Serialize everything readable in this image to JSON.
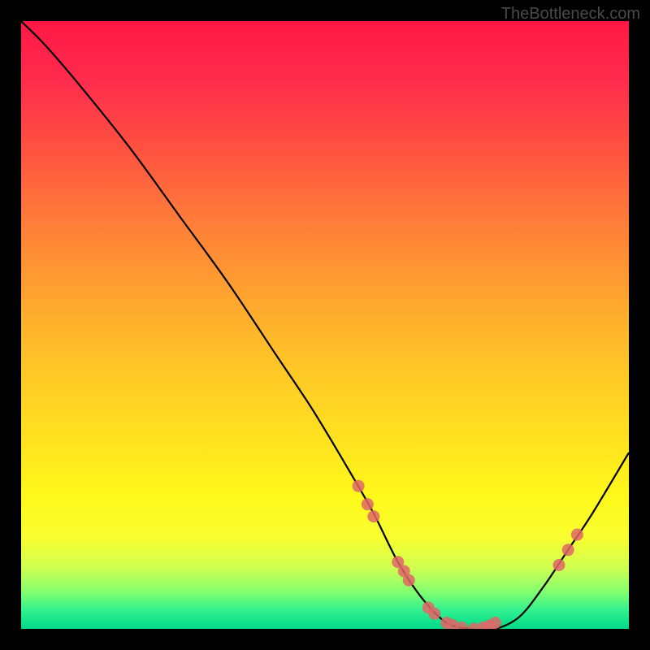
{
  "watermark": "TheBottleneck.com",
  "chart_data": {
    "type": "line",
    "title": "",
    "xlabel": "",
    "ylabel": "",
    "xlim": [
      0,
      100
    ],
    "ylim": [
      0,
      100
    ],
    "series": [
      {
        "name": "curve",
        "x": [
          0,
          4,
          10,
          18,
          26,
          34,
          42,
          48,
          54,
          58,
          62,
          66,
          70,
          74,
          78,
          82,
          86,
          90,
          94,
          100
        ],
        "y": [
          100,
          96,
          89,
          79,
          68,
          57,
          45,
          36,
          26,
          19,
          11,
          5,
          1,
          0,
          0,
          2,
          7,
          13,
          19,
          29
        ]
      }
    ],
    "markers": [
      {
        "x": 55.5,
        "y": 23.5
      },
      {
        "x": 57.0,
        "y": 20.5
      },
      {
        "x": 58.0,
        "y": 18.5
      },
      {
        "x": 62.0,
        "y": 11.0
      },
      {
        "x": 63.0,
        "y": 9.5
      },
      {
        "x": 63.8,
        "y": 8.0
      },
      {
        "x": 67.0,
        "y": 3.5
      },
      {
        "x": 68.0,
        "y": 2.5
      },
      {
        "x": 70.0,
        "y": 1.0
      },
      {
        "x": 71.0,
        "y": 0.6
      },
      {
        "x": 72.5,
        "y": 0.2
      },
      {
        "x": 74.5,
        "y": 0.0
      },
      {
        "x": 76.0,
        "y": 0.2
      },
      {
        "x": 77.0,
        "y": 0.5
      },
      {
        "x": 78.0,
        "y": 1.0
      },
      {
        "x": 88.5,
        "y": 10.5
      },
      {
        "x": 90.0,
        "y": 13.0
      },
      {
        "x": 91.5,
        "y": 15.5
      }
    ],
    "gradient_stops": [
      {
        "pos": 0,
        "color": "#ff1744"
      },
      {
        "pos": 50,
        "color": "#ffd020"
      },
      {
        "pos": 100,
        "color": "#00d988"
      }
    ]
  }
}
